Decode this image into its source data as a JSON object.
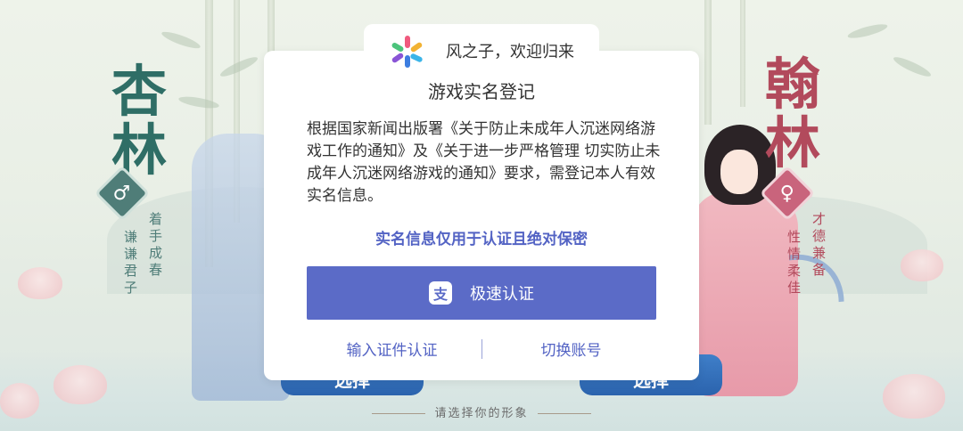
{
  "colors": {
    "accent": "#5b6bc7",
    "link": "#5363c4",
    "male": "#4f7d78",
    "female": "#c9647c",
    "select_button": "#3572bd"
  },
  "background": {
    "left_character": {
      "name": "杏林",
      "gender_icon": "male-icon",
      "motto_line1": "谦谦君子",
      "motto_line2": "着手成春",
      "select_label": "选择"
    },
    "right_character": {
      "name": "翰林",
      "gender_icon": "female-icon",
      "motto_line1": "性情柔佳",
      "motto_line2": "才德兼备",
      "select_label": "选择"
    },
    "choose_hint": "请选择你的形象"
  },
  "modal": {
    "header": {
      "logo_icon": "pinwheel-logo-icon",
      "welcome": "风之子，欢迎归来"
    },
    "title": "游戏实名登记",
    "body": "根据国家新闻出版署《关于防止未成年人沉迷网络游戏工作的通知》及《关于进一步严格管理 切实防止未成年人沉迷网络游戏的通知》要求，需登记本人有效实名信息。",
    "secret_notice": "实名信息仅用于认证且绝对保密",
    "fast_verify": {
      "icon": "alipay-icon",
      "label": "极速认证"
    },
    "id_verify_label": "输入证件认证",
    "switch_account_label": "切换账号"
  }
}
